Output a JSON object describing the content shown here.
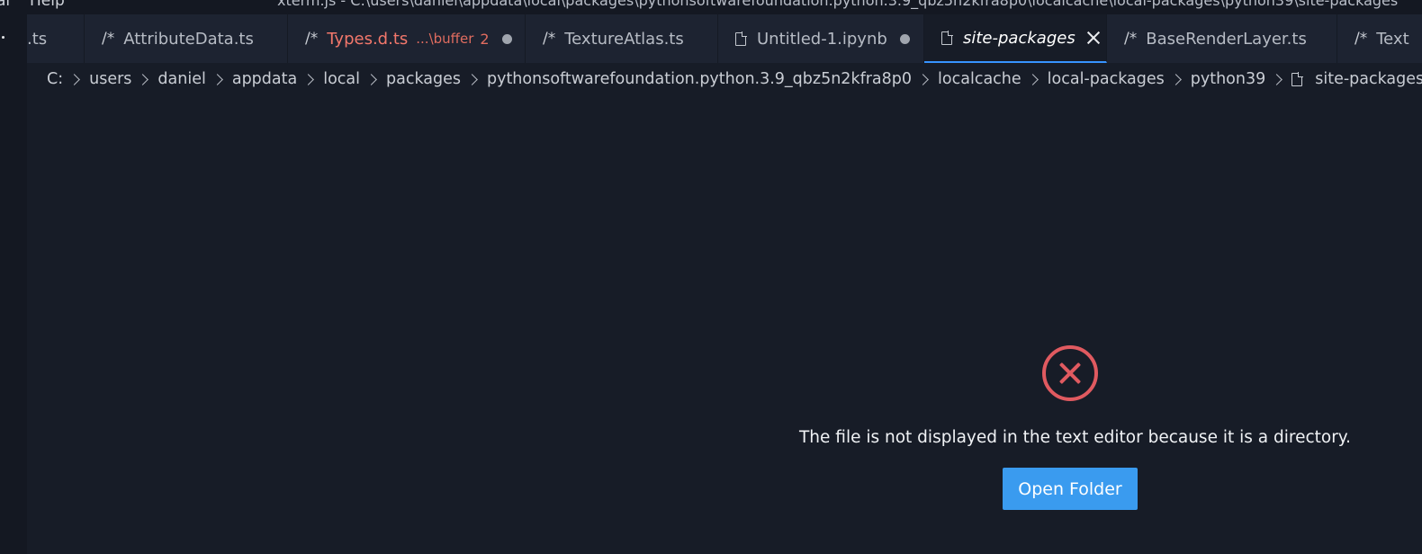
{
  "titlebar": {
    "menu_partial": "al",
    "menu_help": "Help",
    "window_title": "xterm.js - C:\\users\\daniel\\appdata\\local\\packages\\pythonsoftwarefoundation.python.3.9_qbz5n2kfra8p0\\localcache\\local-packages\\python39\\site-packages"
  },
  "tabs": [
    {
      "label": ".ts",
      "prefix": "",
      "icon": "none",
      "state": "normal"
    },
    {
      "label": "AttributeData.ts",
      "prefix": "/*",
      "icon": "comment-icon",
      "state": "normal"
    },
    {
      "label": "Types.d.ts",
      "prefix": "/*",
      "icon": "comment-icon",
      "description": "...\\buffer",
      "problems": "2",
      "state": "error-dirty"
    },
    {
      "label": "TextureAtlas.ts",
      "prefix": "/*",
      "icon": "comment-icon",
      "state": "normal"
    },
    {
      "label": "Untitled-1.ipynb",
      "prefix": "",
      "icon": "file-icon",
      "state": "dirty"
    },
    {
      "label": "site-packages",
      "prefix": "",
      "icon": "file-icon",
      "state": "active"
    },
    {
      "label": "BaseRenderLayer.ts",
      "prefix": "/*",
      "icon": "comment-icon",
      "state": "normal"
    },
    {
      "label": "Text",
      "prefix": "/*",
      "icon": "comment-icon",
      "state": "normal"
    }
  ],
  "breadcrumbs": [
    "C:",
    "users",
    "daniel",
    "appdata",
    "local",
    "packages",
    "pythonsoftwarefoundation.python.3.9_qbz5n2kfra8p0",
    "localcache",
    "local-packages",
    "python39"
  ],
  "breadcrumb_last": "site-packages",
  "editor": {
    "message": "The file is not displayed in the text editor because it is a directory.",
    "button_label": "Open Folder",
    "error_color": "#e05a60",
    "button_color": "#3a9bef"
  }
}
